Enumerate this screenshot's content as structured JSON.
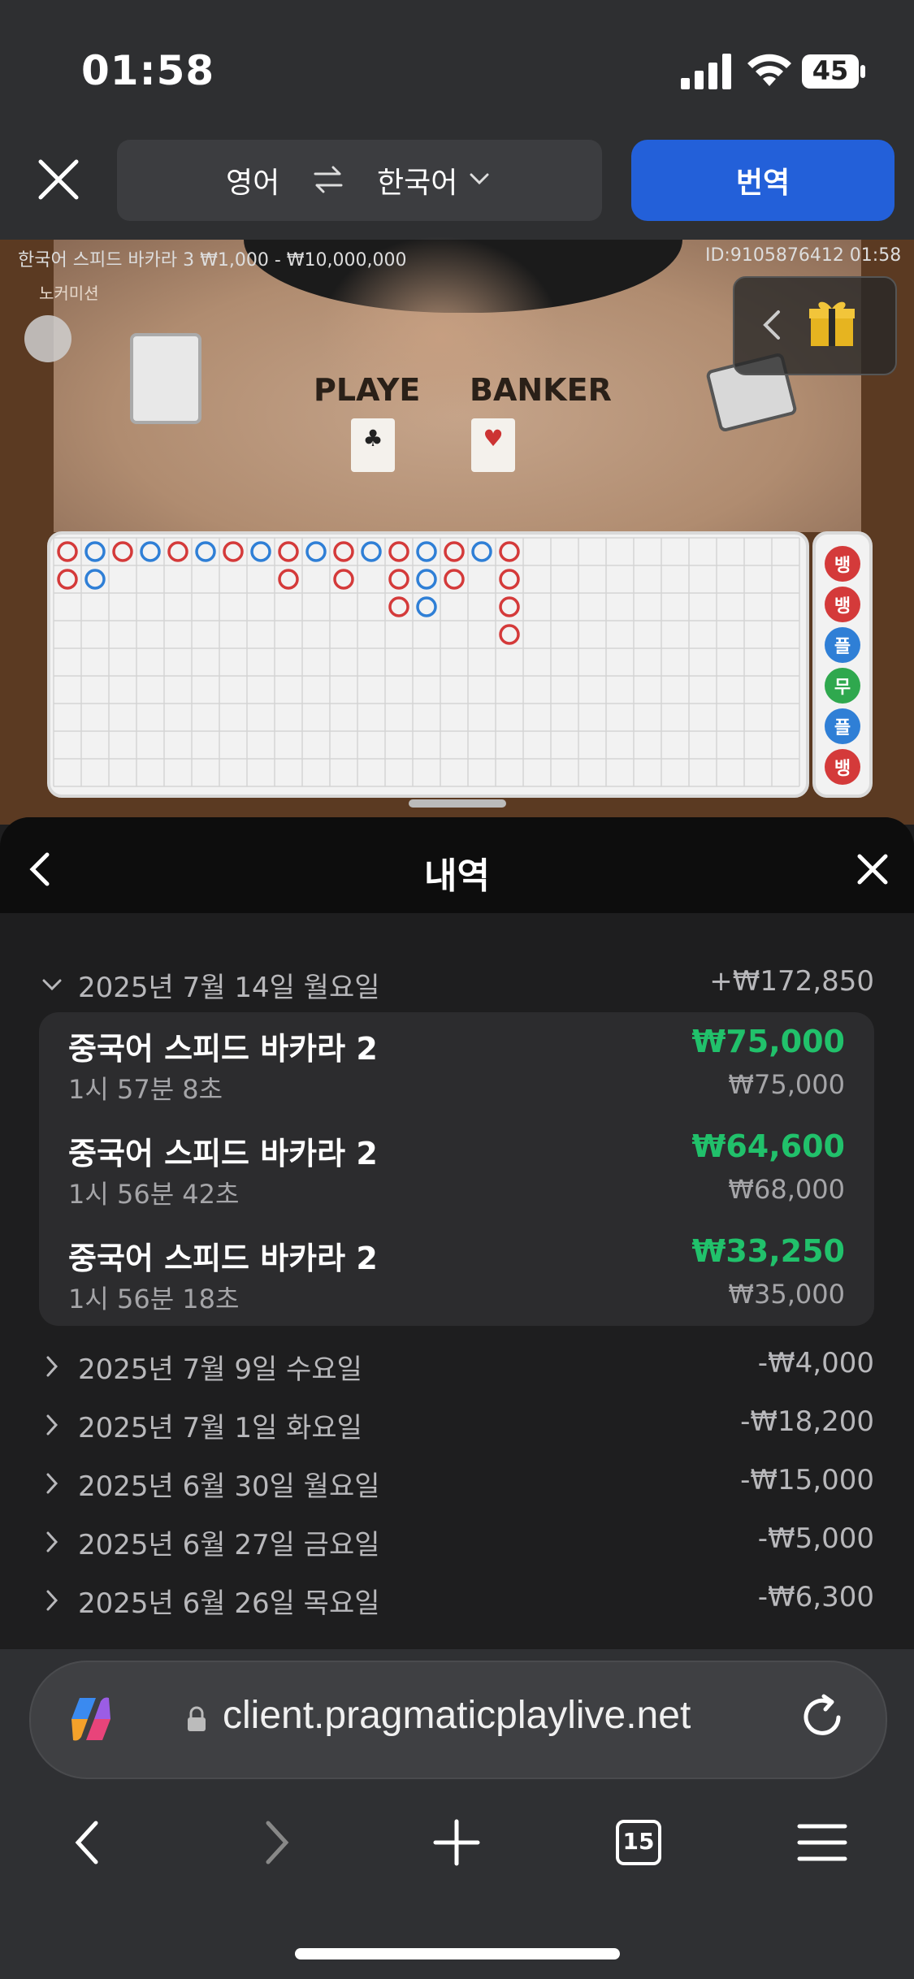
{
  "status_bar": {
    "time": "01:58",
    "battery": "45"
  },
  "translate_bar": {
    "source_lang": "영어",
    "target_lang": "한국어",
    "translate_button": "번역"
  },
  "game": {
    "info": "한국어 스피드 바카라 3  ₩1,000 - ₩10,000,000",
    "id_time": "ID:9105876412  01:58",
    "no_commission": "노커미션",
    "player_label": "PLAYE",
    "banker_label": "BANKER",
    "side_buttons": [
      {
        "label": "뱅",
        "color": "#d43a3a"
      },
      {
        "label": "뱅",
        "color": "#d43a3a"
      },
      {
        "label": "플",
        "color": "#2f7fd6"
      },
      {
        "label": "무",
        "color": "#2fa84e"
      },
      {
        "label": "플",
        "color": "#2f7fd6"
      },
      {
        "label": "뱅",
        "color": "#d43a3a"
      }
    ]
  },
  "history": {
    "title": "내역",
    "expanded_day": {
      "date": "2025년 7월 14일 월요일",
      "total": "+₩172,850",
      "sessions": [
        {
          "name": "중국어 스피드 바카라 2",
          "duration": "1시 57분 8초",
          "win": "₩75,000",
          "bet": "₩75,000"
        },
        {
          "name": "중국어 스피드 바카라 2",
          "duration": "1시 56분 42초",
          "win": "₩64,600",
          "bet": "₩68,000"
        },
        {
          "name": "중국어 스피드 바카라 2",
          "duration": "1시 56분 18초",
          "win": "₩33,250",
          "bet": "₩35,000"
        }
      ]
    },
    "days": [
      {
        "date": "2025년 7월 9일 수요일",
        "total": "-₩4,000"
      },
      {
        "date": "2025년 7월 1일 화요일",
        "total": "-₩18,200"
      },
      {
        "date": "2025년 6월 30일 월요일",
        "total": "-₩15,000"
      },
      {
        "date": "2025년 6월 27일 금요일",
        "total": "-₩5,000"
      },
      {
        "date": "2025년 6월 26일 목요일",
        "total": "-₩6,300"
      }
    ]
  },
  "browser": {
    "url": "client.pragmaticplaylive.net",
    "tab_count": "15"
  },
  "colors": {
    "accent_blue": "#2360d9",
    "win_green": "#21c16b"
  }
}
